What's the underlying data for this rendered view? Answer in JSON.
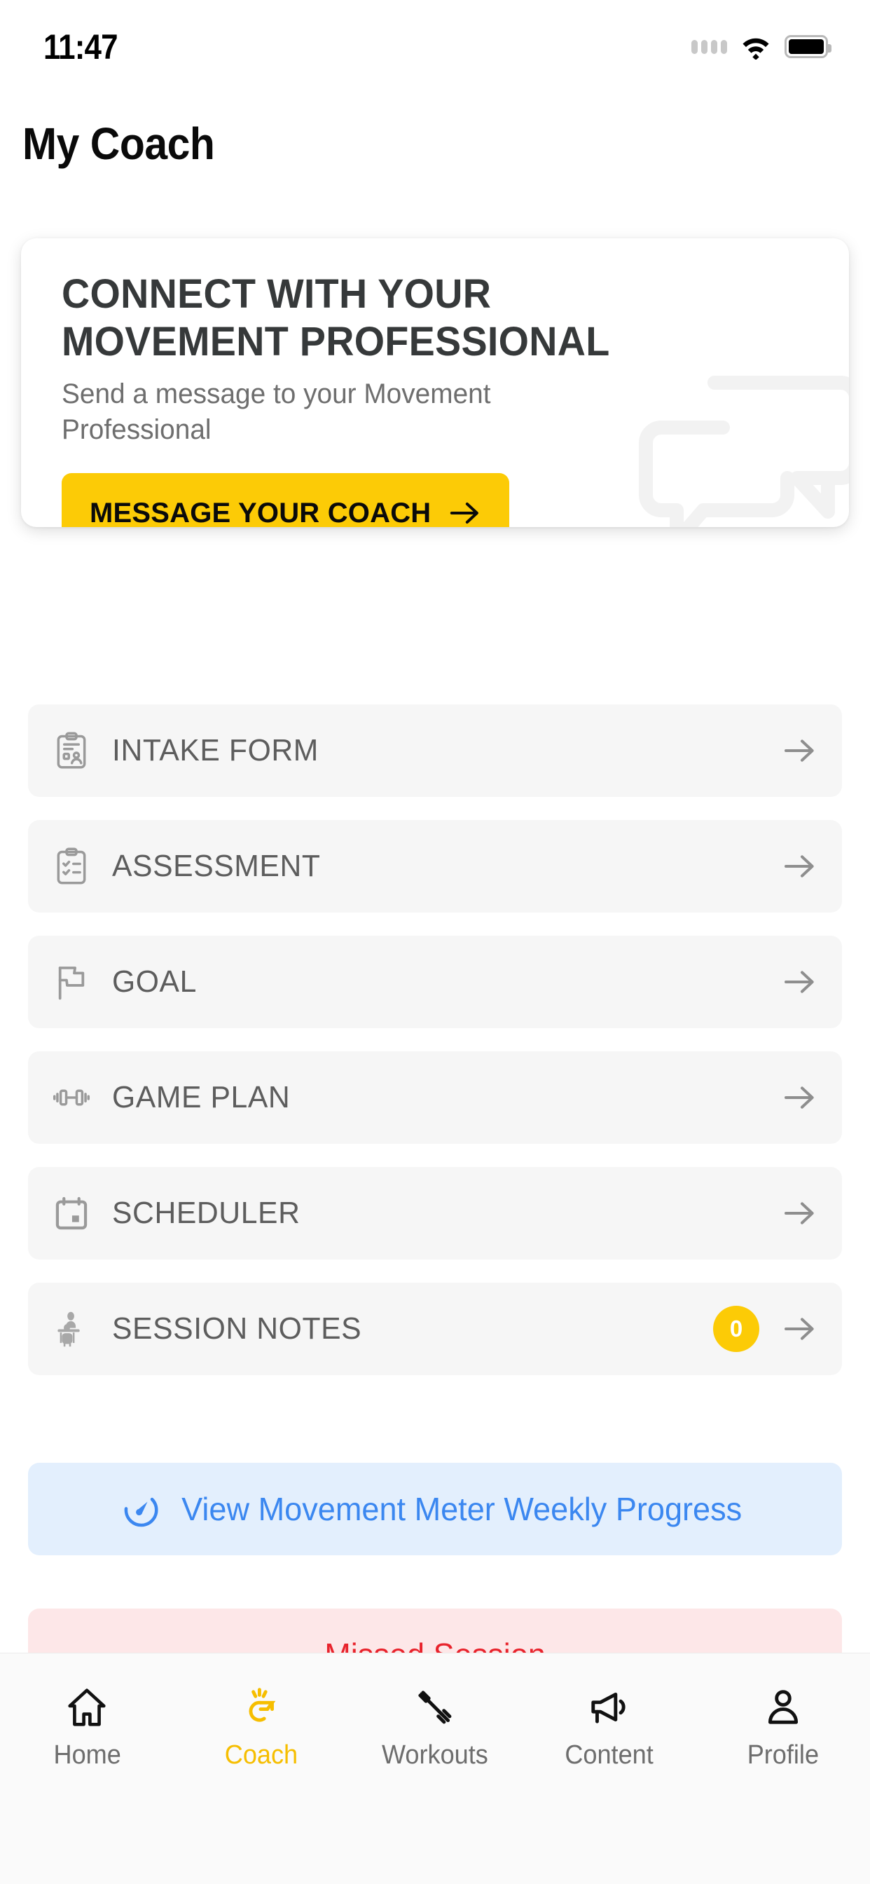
{
  "status_bar": {
    "time": "11:47",
    "signal_icon": "signal-dots-icon",
    "wifi_icon": "wifi-icon",
    "battery_icon": "battery-full-icon"
  },
  "header": {
    "title": "My Coach"
  },
  "hero_card": {
    "title": "CONNECT WITH YOUR MOVEMENT PROFESSIONAL",
    "subtitle": "Send a message to your Movement Professional",
    "cta_label": "MESSAGE YOUR COACH",
    "cta_arrow_icon": "arrow-right-icon",
    "decoration_icon": "chat-bubbles-icon",
    "cta_color": "#FCCB06"
  },
  "menu": {
    "items": [
      {
        "label": "INTAKE FORM",
        "icon": "clipboard-person-icon",
        "badge": null,
        "arrow_icon": "arrow-right-icon"
      },
      {
        "label": "ASSESSMENT",
        "icon": "clipboard-checklist-icon",
        "badge": null,
        "arrow_icon": "arrow-right-icon"
      },
      {
        "label": "GOAL",
        "icon": "flag-icon",
        "badge": null,
        "arrow_icon": "arrow-right-icon"
      },
      {
        "label": "GAME PLAN",
        "icon": "dumbbell-icon",
        "badge": null,
        "arrow_icon": "arrow-right-icon"
      },
      {
        "label": "SCHEDULER",
        "icon": "calendar-icon",
        "badge": null,
        "arrow_icon": "arrow-right-icon"
      },
      {
        "label": "SESSION NOTES",
        "icon": "coach-person-icon",
        "badge": "0",
        "arrow_icon": "arrow-right-icon"
      }
    ]
  },
  "banners": {
    "movement_meter": {
      "label": "View Movement Meter Weekly Progress",
      "icon": "gauge-icon",
      "text_color": "#3B87F0",
      "background_color": "#E3EFFD"
    },
    "missed_session": {
      "label": "Missed Session",
      "text_color": "#E8232C",
      "background_color": "#FDE7E8"
    }
  },
  "tab_bar": {
    "active_color": "#F6BE00",
    "tabs": [
      {
        "label": "Home",
        "icon": "house-icon",
        "active": false
      },
      {
        "label": "Coach",
        "icon": "whistle-icon",
        "active": true
      },
      {
        "label": "Workouts",
        "icon": "barbell-icon",
        "active": false
      },
      {
        "label": "Content",
        "icon": "megaphone-icon",
        "active": false
      },
      {
        "label": "Profile",
        "icon": "person-icon",
        "active": false
      }
    ]
  }
}
